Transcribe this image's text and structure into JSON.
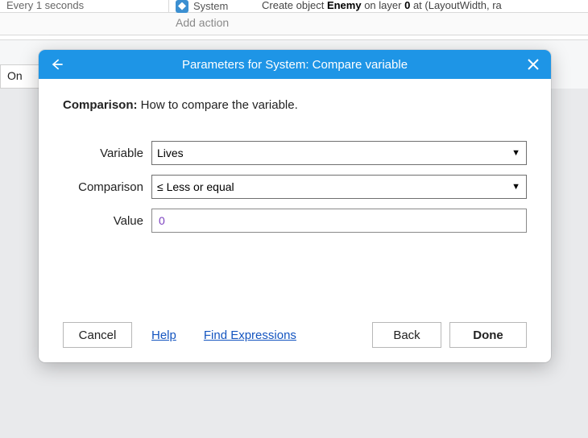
{
  "background": {
    "row1_left": "Every 1 seconds",
    "system_label": "System",
    "action_text_pre": "Create object ",
    "action_obj": "Enemy",
    "action_text_mid": " on layer ",
    "action_layer": "0",
    "action_text_post": " at (LayoutWidth, ra",
    "add_action": "Add action",
    "event_trigger": "On"
  },
  "dialog": {
    "title": "Parameters for System: Compare variable",
    "description_label": "Comparison:",
    "description_text": " How to compare the variable.",
    "fields": {
      "variable": {
        "label": "Variable",
        "value": "Lives"
      },
      "comparison": {
        "label": "Comparison",
        "value": "≤ Less or equal"
      },
      "value": {
        "label": "Value",
        "value": "0"
      }
    },
    "buttons": {
      "cancel": "Cancel",
      "help": "Help",
      "find_expressions": "Find Expressions",
      "back": "Back",
      "done": "Done"
    }
  }
}
